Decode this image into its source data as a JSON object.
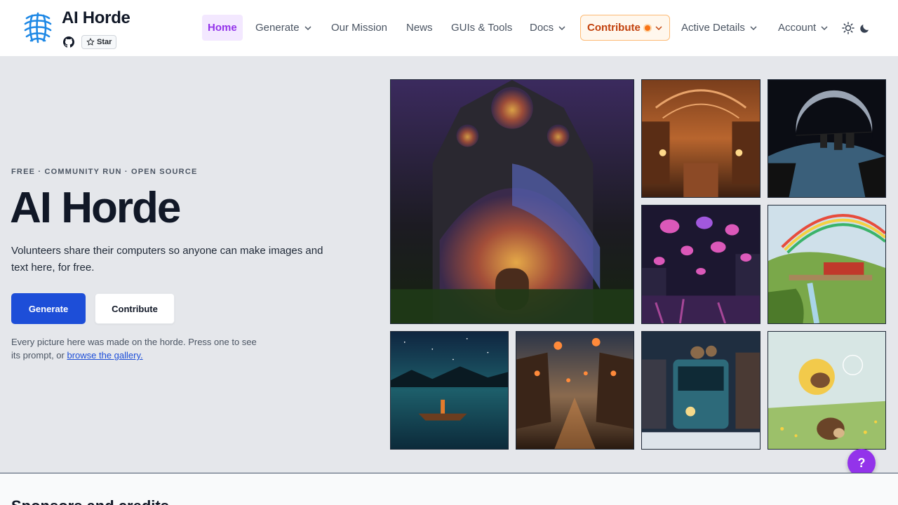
{
  "brand": {
    "title": "AI Horde",
    "star_label": "Star"
  },
  "nav": {
    "home": "Home",
    "generate": "Generate",
    "mission": "Our Mission",
    "news": "News",
    "guis": "GUIs & Tools",
    "docs": "Docs",
    "contribute": "Contribute",
    "active": "Active Details",
    "account": "Account"
  },
  "hero": {
    "eyebrow": "FREE · COMMUNITY RUN · OPEN SOURCE",
    "title": "AI Horde",
    "description": "Volunteers share their computers so anyone can make images and text here, for free.",
    "generate_label": "Generate",
    "contribute_label": "Contribute",
    "note_text": "Every picture here was made on the horde. Press one to see its prompt, or ",
    "note_link": "browse the gallery."
  },
  "help": {
    "label": "?"
  },
  "sponsors": {
    "title": "Sponsors and credits"
  },
  "colors": {
    "accent": "#9333ea",
    "primary": "#1d4ed8",
    "contribute": "#c2410c"
  }
}
